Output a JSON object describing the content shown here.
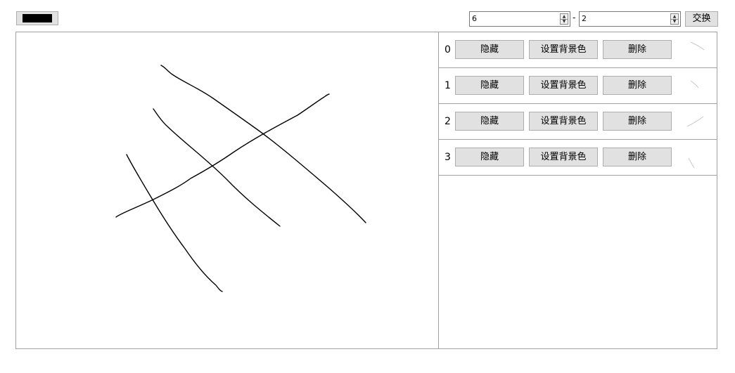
{
  "toolbar": {
    "color": "#000000",
    "from_value": "6",
    "separator": "-",
    "to_value": "2",
    "swap_label": "交换"
  },
  "layers": [
    {
      "index": "0",
      "hide_label": "隐藏",
      "bg_label": "设置背景色",
      "delete_label": "删除"
    },
    {
      "index": "1",
      "hide_label": "隐藏",
      "bg_label": "设置背景色",
      "delete_label": "删除"
    },
    {
      "index": "2",
      "hide_label": "隐藏",
      "bg_label": "设置背景色",
      "delete_label": "删除"
    },
    {
      "index": "3",
      "hide_label": "隐藏",
      "bg_label": "设置背景色",
      "delete_label": "删除"
    }
  ],
  "stroke_color": "#000000",
  "thumb_color": "#c8c8c8"
}
